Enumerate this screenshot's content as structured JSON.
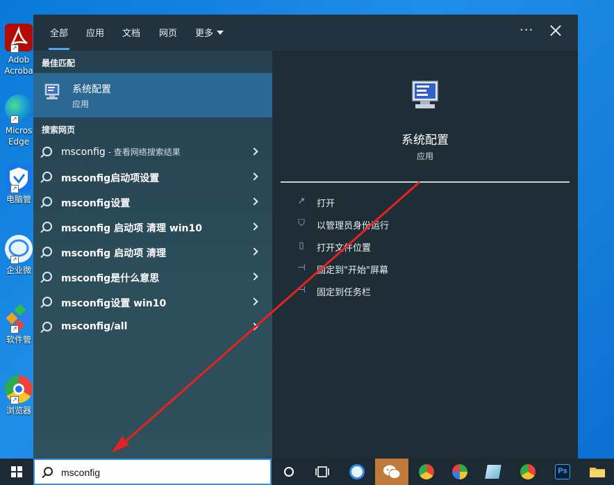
{
  "desktop": {
    "icons": [
      {
        "label": "Adob\nAcroba",
        "name": "acrobat"
      },
      {
        "label": "Micros\nEdge",
        "name": "edge"
      },
      {
        "label": "电脑管",
        "name": "pc-manager"
      },
      {
        "label": "企业微",
        "name": "wecom"
      },
      {
        "label": "软件管",
        "name": "software-manager"
      },
      {
        "label": "浏览器",
        "name": "browser"
      }
    ]
  },
  "tabs": {
    "all": "全部",
    "apps": "应用",
    "docs": "文档",
    "web": "网页",
    "more": "更多",
    "dots": "···"
  },
  "left": {
    "best_match_heading": "最佳匹配",
    "best_match": {
      "title": "系统配置",
      "subtitle": "应用"
    },
    "web_heading": "搜索网页",
    "web_results": [
      {
        "main": "msconfig",
        "sub": " - 查看网络搜索结果"
      },
      {
        "main": "msconfig启动项设置",
        "sub": ""
      },
      {
        "main": "msconfig设置",
        "sub": ""
      },
      {
        "main": "msconfig 启动项 清理 win10",
        "sub": ""
      },
      {
        "main": "msconfig 启动项 清理",
        "sub": ""
      },
      {
        "main": "msconfig是什么意思",
        "sub": ""
      },
      {
        "main": "msconfig设置 win10",
        "sub": ""
      },
      {
        "main": "msconfig/all",
        "sub": ""
      }
    ]
  },
  "preview": {
    "title": "系统配置",
    "subtitle": "应用",
    "actions": [
      {
        "label": "打开",
        "icon": "open-icon"
      },
      {
        "label": "以管理员身份运行",
        "icon": "shield-icon"
      },
      {
        "label": "打开文件位置",
        "icon": "folder-icon"
      },
      {
        "label": "固定到\"开始\"屏幕",
        "icon": "pin-icon"
      },
      {
        "label": "固定到任务栏",
        "icon": "pin-icon"
      }
    ]
  },
  "taskbar": {
    "search_value": "msconfig"
  },
  "colors": {
    "accent": "#4ea3f2",
    "best_match_bg": "#2b6793",
    "arrow": "#e8231f"
  }
}
